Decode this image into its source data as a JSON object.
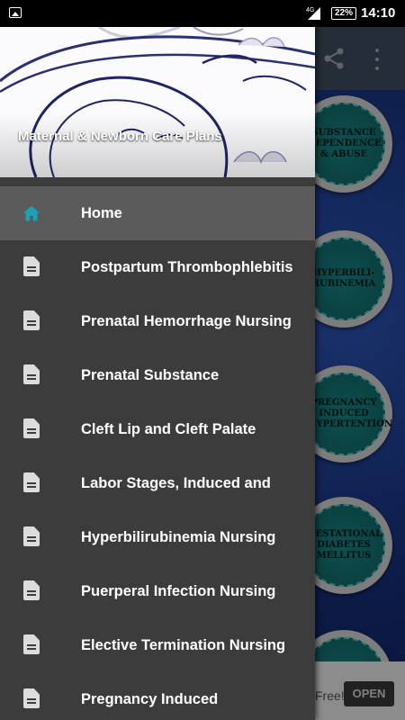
{
  "status_bar": {
    "network": "4G",
    "battery": "22%",
    "time": "14:10"
  },
  "drawer": {
    "header_title": "Maternal & Newborn Care Plans",
    "items": [
      {
        "label": "Home",
        "icon": "home-icon",
        "active": true
      },
      {
        "label": "Postpartum Thrombophlebitis",
        "icon": "document-icon"
      },
      {
        "label": "Prenatal Hemorrhage Nursing",
        "icon": "document-icon"
      },
      {
        "label": "Prenatal Substance",
        "icon": "document-icon"
      },
      {
        "label": "Cleft Lip and Cleft Palate",
        "icon": "document-icon"
      },
      {
        "label": "Labor Stages, Induced and",
        "icon": "document-icon"
      },
      {
        "label": "Hyperbilirubinemia Nursing",
        "icon": "document-icon"
      },
      {
        "label": "Puerperal Infection Nursing",
        "icon": "document-icon"
      },
      {
        "label": "Elective Termination Nursing",
        "icon": "document-icon"
      },
      {
        "label": "Pregnancy Induced",
        "icon": "document-icon"
      }
    ]
  },
  "background": {
    "tiles": [
      "SUBSTANCE DEPENDENCE & ABUSE",
      "HYPERBILI-RUBINEMIA",
      "PREGNANCY INDUCED HYPERTENTION",
      "GESTATIONAL DIABETES MELLITUS"
    ],
    "ad_text": "Free!",
    "ad_button": "OPEN"
  },
  "colors": {
    "drawer_bg": "#3c3c3c",
    "active_item_bg": "#5b5b5b",
    "home_icon": "#1aa3b8",
    "background_blue": "#1d3b8a",
    "tile_teal": "#137070"
  }
}
